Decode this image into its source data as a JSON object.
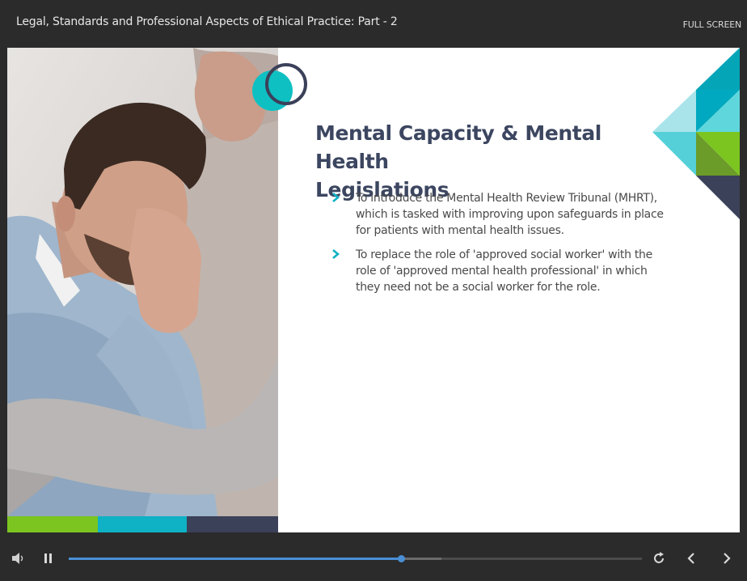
{
  "header": {
    "course_title": "Legal, Standards and Professional Aspects of Ethical Practice: Part - 2",
    "fullscreen_label": "FULL SCREEN"
  },
  "slide": {
    "title_line1": "Mental Capacity & Mental Health",
    "title_line2": "Legislations",
    "bullets": [
      {
        "lines": [
          "To introduce the Mental Health Review Tribunal (MHRT),",
          "which is tasked with improving upon safeguards in place",
          "for patients with mental health issues."
        ]
      },
      {
        "lines": [
          "To replace the role of 'approved social worker' with the",
          "role of 'approved mental health professional' in which",
          "they need not be a social worker for the role."
        ]
      }
    ],
    "colors": {
      "accent_teal": "#0fb1c4",
      "accent_green": "#7cc520",
      "accent_navy": "#3b4159",
      "title_color": "#3c4660"
    }
  },
  "player": {
    "icons": {
      "volume": "volume-icon",
      "pause": "pause-icon",
      "replay": "replay-icon",
      "prev": "chevron-left-icon",
      "next": "chevron-right-icon"
    },
    "progress_fraction": 0.58,
    "buffered_fraction": 0.65
  }
}
